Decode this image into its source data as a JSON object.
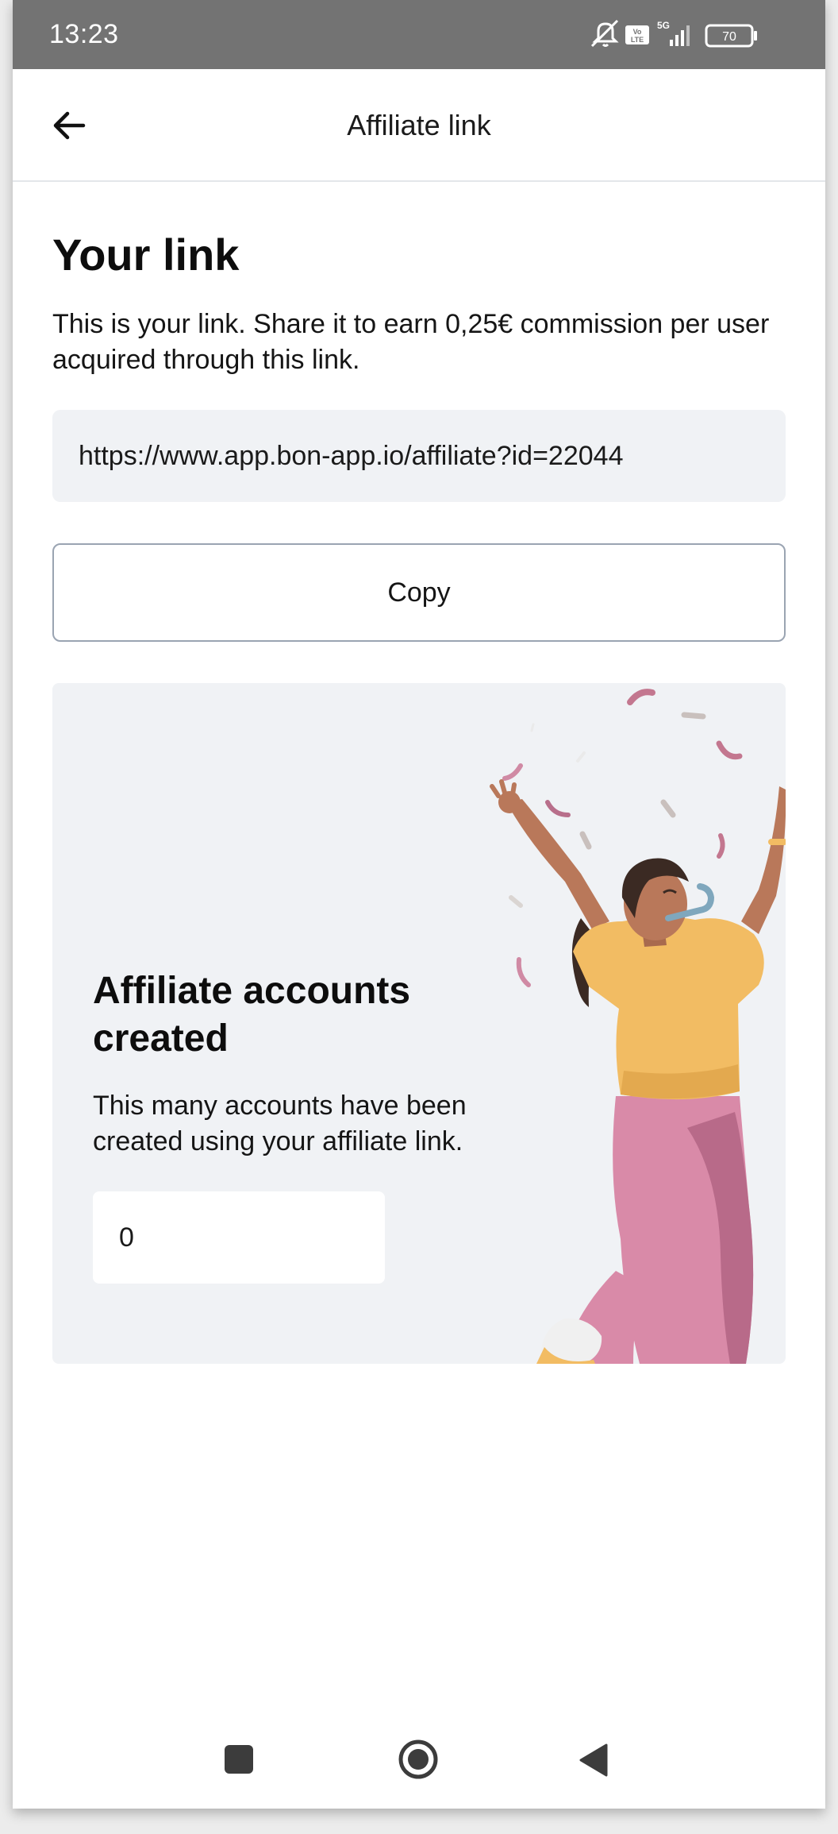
{
  "status_bar": {
    "time": "13:23",
    "battery": "70",
    "network": "5G"
  },
  "app_bar": {
    "title": "Affiliate link"
  },
  "link_section": {
    "title": "Your link",
    "description": "This is your link. Share it to earn 0,25€ commission per user acquired through this link.",
    "link_value": "https://www.app.bon-app.io/affiliate?id=22044",
    "copy_label": "Copy"
  },
  "stats_section": {
    "title": "Affiliate accounts created",
    "description": "This many accounts have been created using your affiliate link.",
    "count": "0"
  },
  "colors": {
    "status_bar": "#737373",
    "field_bg": "#f0f2f5",
    "button_border": "#9aa4b2",
    "shirt": "#f2bc63",
    "pants": "#d98aa8",
    "skin": "#b9785a"
  }
}
